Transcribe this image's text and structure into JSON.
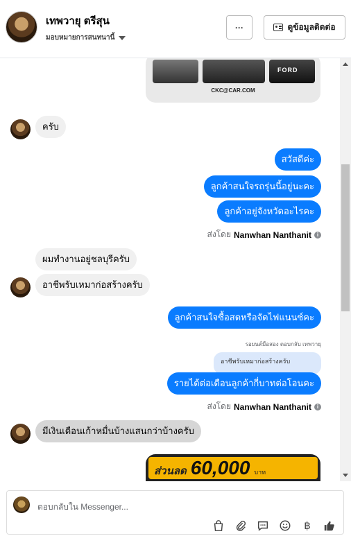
{
  "header": {
    "name": "เทพวายุ ตรีสุน",
    "assign_label": "มอบหมายการสนทนานี้",
    "more_label": "···",
    "contact_label": "ดูข้อมูลติดต่อ"
  },
  "images": {
    "top_brand": "FORD",
    "top_caption": "CKC@CAR.COM",
    "bottom_label": "ส่วนลด",
    "bottom_amount": "60,000",
    "bottom_unit": "บาท"
  },
  "messages": [
    {
      "side": "in",
      "text": "ครับ"
    },
    {
      "side": "out",
      "text": "สวัสดีค่ะ"
    },
    {
      "side": "out",
      "text": "ลูกค้าสนใจรถรุ่นนี้อยู่นะคะ"
    },
    {
      "side": "out",
      "text": "ลูกค้าอยู่จังหวัดอะไรคะ"
    },
    {
      "side": "in",
      "text": "ผมทำงานอยู่ชลบุรีครับ"
    },
    {
      "side": "in",
      "text": "อาชีพรับเหมาก่อสร้างครับ"
    },
    {
      "side": "out",
      "text": "ลูกค้าสนใจซื้อสดหรือจัดไฟแนนซ์คะ"
    },
    {
      "side": "out",
      "text": "รายได้ต่อเดือนลูกค้ากี่บาทต่อโอนคะ"
    },
    {
      "side": "in",
      "text": "มีเงินเดือนเก้าหมื่นบ้างแสนกว่าบ้างครับ"
    }
  ],
  "sent_by": {
    "prefix": "ส่งโดย",
    "name": "Nanwhan Nanthanit",
    "info_icon": "i"
  },
  "reply": {
    "note": "รอยนต์มือสอง ตอบกลับ เทพวายุ",
    "quote": "อาชีพรับเหมาก่อสร้างครับ"
  },
  "composer": {
    "placeholder": "ตอบกลับใน Messenger...",
    "icons": [
      "shopping-bag-icon",
      "paperclip-icon",
      "chat-icon",
      "emoji-icon",
      "baht-icon",
      "thumbs-up-icon"
    ],
    "baht_symbol": "฿"
  },
  "colors": {
    "outgoing": "#0a7cff",
    "incoming": "#f0f0f0"
  }
}
